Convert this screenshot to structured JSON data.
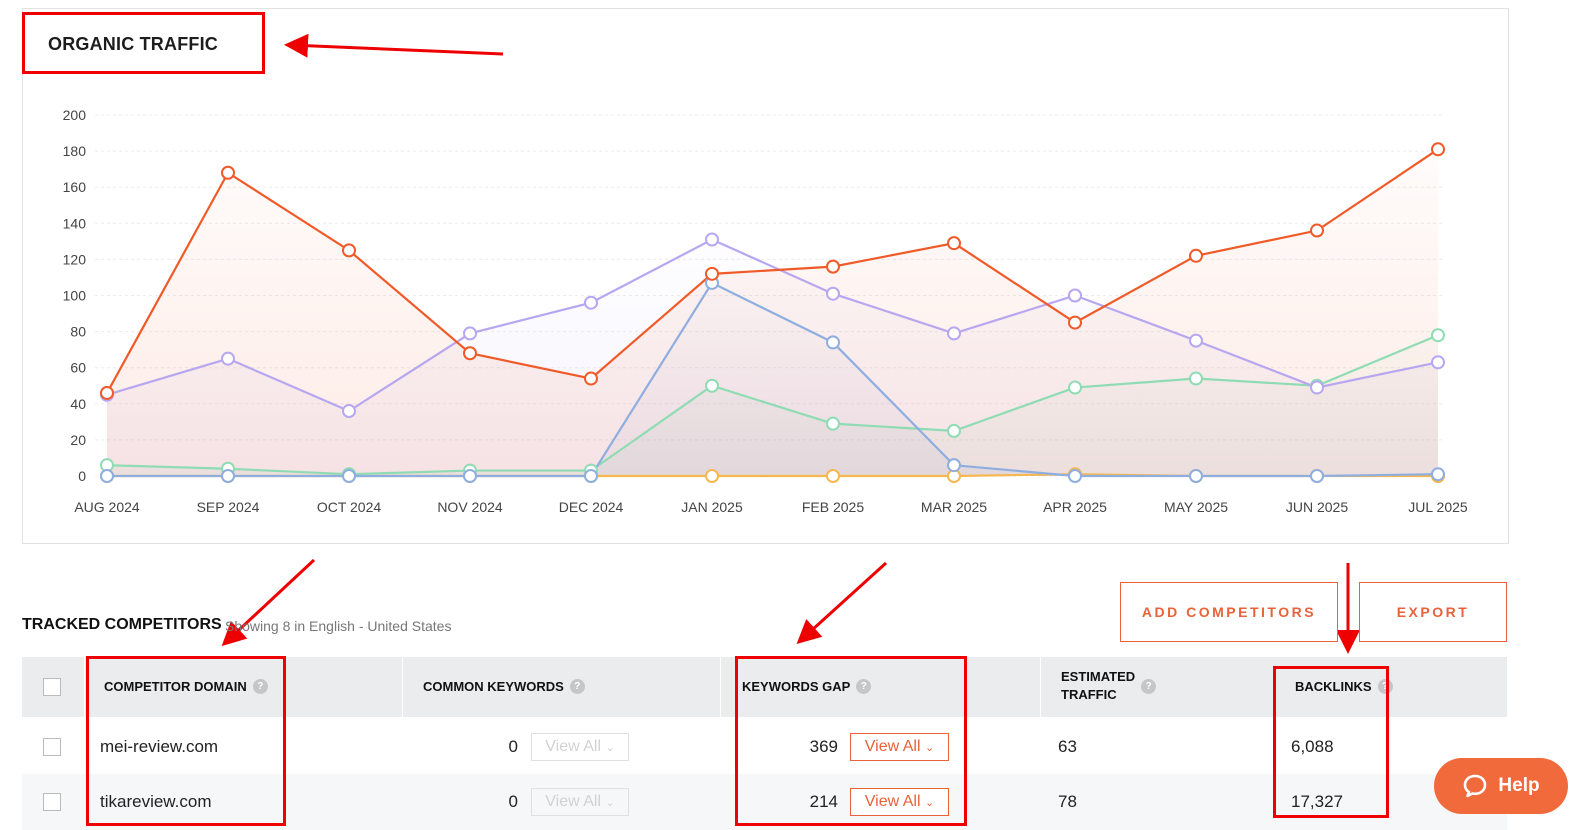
{
  "chart_title": "ORGANIC TRAFFIC",
  "chart_data": {
    "type": "line",
    "categories": [
      "AUG 2024",
      "SEP 2024",
      "OCT 2024",
      "NOV 2024",
      "DEC 2024",
      "JAN 2025",
      "FEB 2025",
      "MAR 2025",
      "APR 2025",
      "MAY 2025",
      "JUN 2025",
      "JUL 2025"
    ],
    "y_ticks": [
      "0",
      "20",
      "40",
      "60",
      "80",
      "100",
      "120",
      "140",
      "160",
      "180",
      "200"
    ],
    "ylim": [
      0,
      200
    ],
    "grid": true,
    "series": [
      {
        "color": "#f05a28",
        "values": [
          46,
          168,
          125,
          68,
          54,
          112,
          116,
          129,
          85,
          122,
          136,
          181
        ]
      },
      {
        "color": "#b7a6f0",
        "values": [
          45,
          65,
          36,
          79,
          96,
          131,
          101,
          79,
          100,
          75,
          49,
          63
        ]
      },
      {
        "color": "#8faee0",
        "values": [
          0,
          0,
          0,
          0,
          0,
          107,
          74,
          6,
          0,
          0,
          0,
          1
        ]
      },
      {
        "color": "#8fdcb4",
        "values": [
          6,
          4,
          1,
          3,
          3,
          50,
          29,
          25,
          49,
          54,
          50,
          78
        ]
      },
      {
        "color": "#f5b74f",
        "values": [
          0,
          0,
          0,
          0,
          0,
          0,
          0,
          0,
          1,
          0,
          0,
          0
        ]
      }
    ]
  },
  "competitors": {
    "title": "TRACKED COMPETITORS",
    "subtitle": "Showing 8 in English - United States",
    "add_button": "ADD COMPETITORS",
    "export_button": "EXPORT",
    "columns": {
      "domain": "COMPETITOR DOMAIN",
      "common": "COMMON KEYWORDS",
      "gap": "KEYWORDS GAP",
      "traffic_line1": "ESTIMATED",
      "traffic_line2": "TRAFFIC",
      "backlinks": "BACKLINKS"
    },
    "view_all_label": "View All",
    "rows": [
      {
        "domain": "mei-review.com",
        "common": "0",
        "gap": "369",
        "traffic": "63",
        "backlinks": "6,088"
      },
      {
        "domain": "tikareview.com",
        "common": "0",
        "gap": "214",
        "traffic": "78",
        "backlinks": "17,327"
      }
    ]
  },
  "help_label": "Help",
  "colors": {
    "accent": "#f06a3c",
    "annotation": "#ee0000"
  }
}
